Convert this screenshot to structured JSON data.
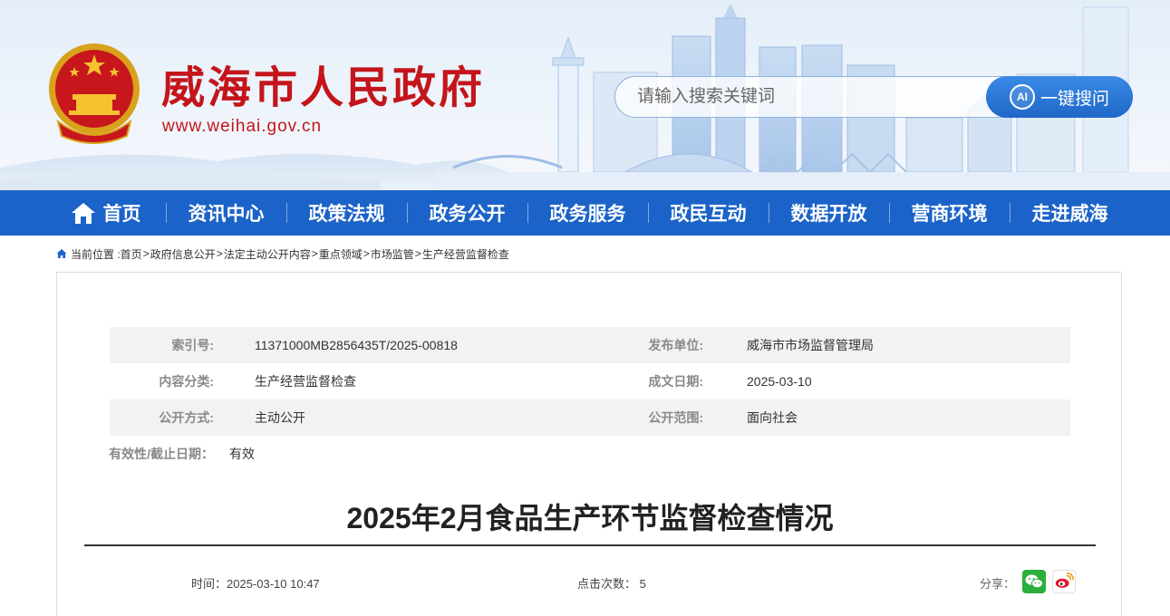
{
  "header": {
    "site_title": "威海市人民政府",
    "site_url": "www.weihai.gov.cn",
    "search_placeholder": "请输入搜索关键词",
    "search_button": "一键搜问",
    "ai_label": "AI"
  },
  "nav": {
    "items": [
      {
        "label": "首页"
      },
      {
        "label": "资讯中心"
      },
      {
        "label": "政策法规"
      },
      {
        "label": "政务公开"
      },
      {
        "label": "政务服务"
      },
      {
        "label": "政民互动"
      },
      {
        "label": "数据开放"
      },
      {
        "label": "营商环境"
      },
      {
        "label": "走进威海"
      }
    ]
  },
  "breadcrumb": {
    "prefix": "当前位置 :",
    "items": [
      "首页",
      "政府信息公开",
      "法定主动公开内容",
      "重点领域",
      "市场监管",
      "生产经营监督检查"
    ],
    "separator": ">"
  },
  "meta": {
    "index_label": "索引号:",
    "index_value": "11371000MB2856435T/2025-00818",
    "publisher_label": "发布单位:",
    "publisher_value": "威海市市场监督管理局",
    "category_label": "内容分类:",
    "category_value": "生产经营监督检查",
    "date_label": "成文日期:",
    "date_value": "2025-03-10",
    "method_label": "公开方式:",
    "method_value": "主动公开",
    "scope_label": "公开范围:",
    "scope_value": "面向社会",
    "validity_label": "有效性/截止日期：",
    "validity_value": "有效"
  },
  "article": {
    "title": "2025年2月食品生产环节监督检查情况",
    "time_label": "时间：",
    "time_value": "2025-03-10 10:47",
    "clicks_label": "点击次数：",
    "clicks_value": "5",
    "share_label": "分享："
  },
  "colors": {
    "brand_red": "#c3151b",
    "nav_blue": "#1b63c8",
    "search_blue": "#1f67c8"
  }
}
